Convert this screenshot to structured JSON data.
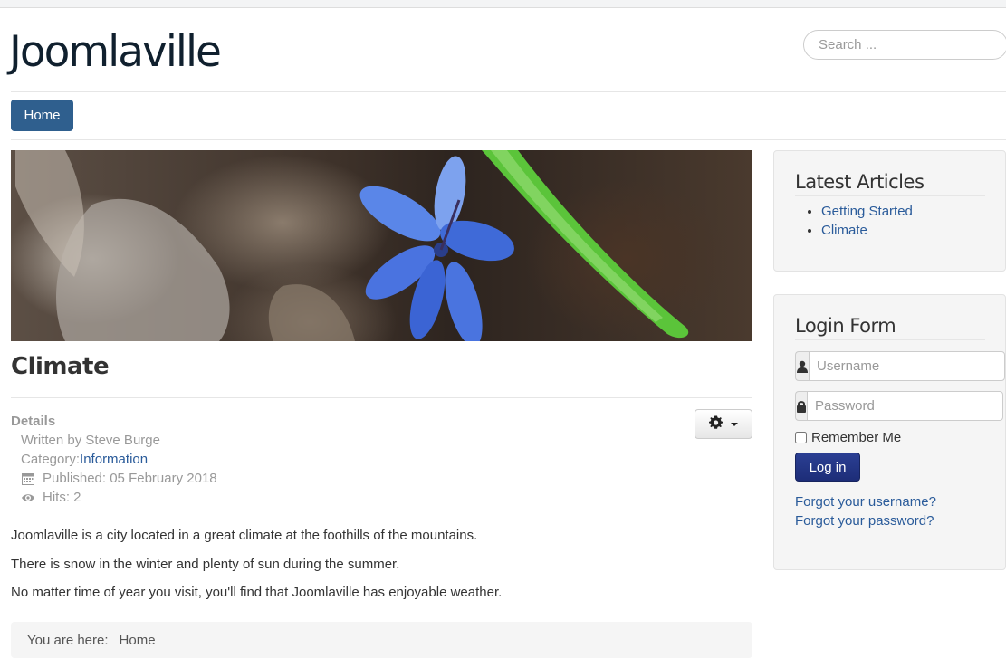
{
  "site": {
    "title": "Joomlaville",
    "search_placeholder": "Search ..."
  },
  "nav": {
    "items": [
      {
        "label": "Home",
        "active": true
      }
    ]
  },
  "banner": {
    "description": "Blue flower among dry leaves with a green leaf blade"
  },
  "article": {
    "title": "Climate",
    "details_label": "Details",
    "written_by": "Written by Steve Burge",
    "category_prefix": "Category: ",
    "category_link": "Information",
    "published": "Published: 05 February 2018",
    "hits": "Hits: 2",
    "paragraphs": [
      "Joomlaville is a city located in a great climate at the foothills of the mountains.",
      "There is snow in the winter and plenty of sun during the summer.",
      "No matter time of year you visit, you'll find that Joomlaville has enjoyable weather."
    ],
    "tools_icon": "gear-icon"
  },
  "breadcrumb": {
    "label": "You are here:",
    "items": [
      "Home"
    ]
  },
  "sidebar": {
    "latest_articles": {
      "title": "Latest Articles",
      "items": [
        "Getting Started",
        "Climate"
      ]
    },
    "login": {
      "title": "Login Form",
      "username_placeholder": "Username",
      "password_placeholder": "Password",
      "remember_label": "Remember Me",
      "login_label": "Log in",
      "forgot_username": "Forgot your username?",
      "forgot_password": "Forgot your password?"
    }
  },
  "colors": {
    "nav_active": "#2f5f8e",
    "link": "#2a5b9a",
    "login_button": "#1d2d78",
    "panel_bg": "#f5f5f5"
  }
}
